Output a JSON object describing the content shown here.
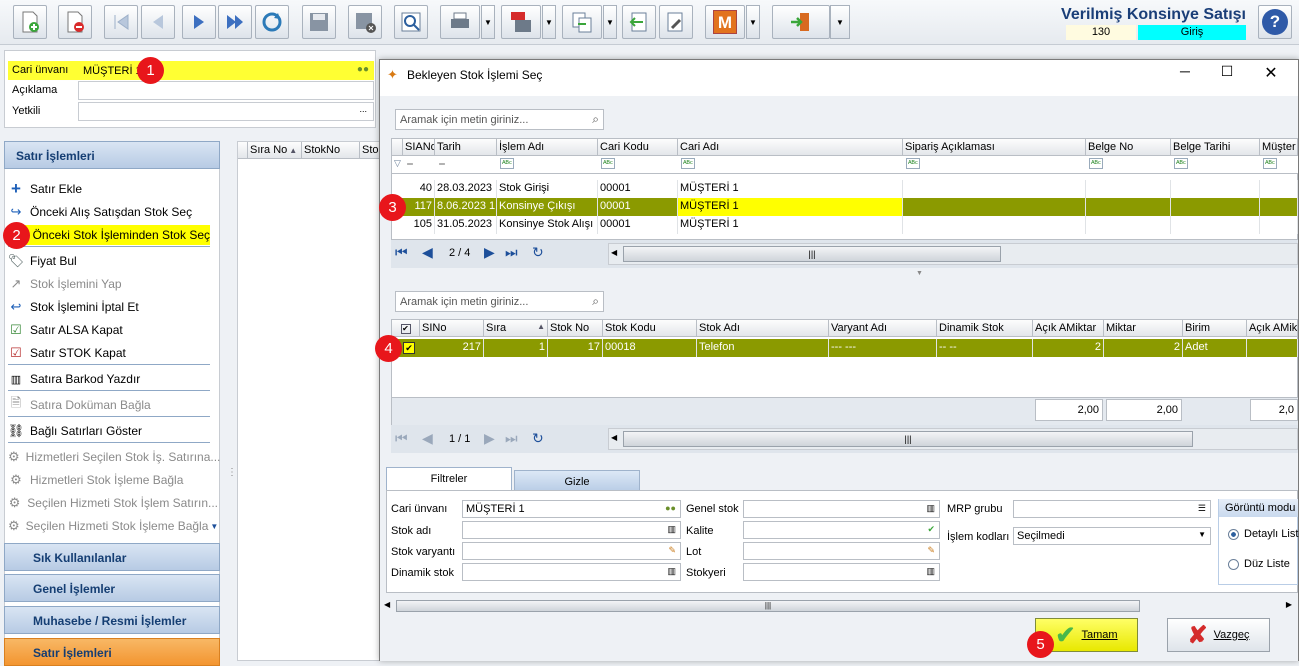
{
  "window_title": "Verilmiş Konsinye Satışı",
  "doc_number": "130",
  "doc_type": "Giriş",
  "header_fields": [
    {
      "label": "Cari ünvanı",
      "value": "MÜŞTERİ 1"
    },
    {
      "label": "Açıklama",
      "value": ""
    },
    {
      "label": "Yetkili",
      "value": "..."
    }
  ],
  "callouts": [
    "1",
    "2",
    "3",
    "4",
    "5"
  ],
  "nav": {
    "title": "Satır İşlemleri",
    "items": [
      {
        "label": "Satır Ekle",
        "icon": "plus-icon",
        "enabled": true
      },
      {
        "label": "Önceki Alış Satışdan Stok Seç",
        "icon": "redo-icon",
        "enabled": true
      },
      {
        "label": "Önceki Stok İşleminden Stok Seç",
        "icon": "redo-icon",
        "enabled": true,
        "highlight": true
      },
      {
        "label": "Fiyat Bul",
        "icon": "tag-icon",
        "enabled": true
      },
      {
        "label": "Stok İşlemini Yap",
        "icon": "share-icon",
        "enabled": false
      },
      {
        "label": "Stok İşlemini İptal Et",
        "icon": "undo-icon",
        "enabled": true
      },
      {
        "label": "Satır ALSA Kapat",
        "icon": "check-doc-icon",
        "enabled": true
      },
      {
        "label": "Satır STOK Kapat",
        "icon": "check-doc-icon",
        "enabled": true
      },
      {
        "label": "Satıra Barkod Yazdır",
        "icon": "barcode-icon",
        "enabled": true
      },
      {
        "label": "Satıra Doküman Bağla",
        "icon": "doc-icon",
        "enabled": false
      },
      {
        "label": "Bağlı Satırları Göster",
        "icon": "link-icon",
        "enabled": true
      },
      {
        "label": "Hizmetleri Seçilen Stok İş. Satırına...",
        "icon": "gear-icon",
        "enabled": false
      },
      {
        "label": "Hizmetleri Stok İşleme Bağla",
        "icon": "gear-icon",
        "enabled": false
      },
      {
        "label": "Seçilen Hizmeti Stok İşlem Satırın...",
        "icon": "gear-icon",
        "enabled": false
      },
      {
        "label": "Seçilen Hizmeti Stok İşleme Bağla",
        "icon": "gear-icon",
        "enabled": false
      }
    ],
    "groups": [
      "Sık Kullanılanlar",
      "Genel İşlemler",
      "Muhasebe / Resmi İşlemler",
      "Satır İşlemleri"
    ]
  },
  "main_grid_headers": [
    "Sıra No",
    "StokNo",
    "Sto"
  ],
  "dialog": {
    "title": "Bekleyen Stok İşlemi Seç",
    "search_placeholder_1": "Aramak için metin giriniz...",
    "search_placeholder_2": "Aramak için metin giriniz...",
    "grid1": {
      "headers": [
        "SIANo",
        "Tarih",
        "İşlem Adı",
        "Cari Kodu",
        "Cari Adı",
        "Sipariş Açıklaması",
        "Belge No",
        "Belge Tarihi",
        "Müşter"
      ],
      "rows": [
        [
          "40",
          "28.03.2023",
          "Stok Girişi",
          "00001",
          "MÜŞTERİ 1",
          "",
          "",
          "",
          ""
        ],
        [
          "117",
          "8.06.2023 1",
          "Konsinye Çıkışı",
          "00001",
          "MÜŞTERİ 1",
          "",
          "",
          "",
          ""
        ],
        [
          "105",
          "31.05.2023",
          "Konsinye Stok Alışı",
          "00001",
          "MÜŞTERİ 1",
          "",
          "",
          "",
          ""
        ]
      ],
      "page": "2 / 4"
    },
    "grid2": {
      "headers": [
        "SINo",
        "Sıra",
        "Stok No",
        "Stok Kodu",
        "Stok Adı",
        "Varyant Adı",
        "Dinamik Stok",
        "Açık AMiktar",
        "Miktar",
        "Birim",
        "Açık AMikt"
      ],
      "rows": [
        [
          "217",
          "1",
          "17",
          "00018",
          "Telefon",
          "--- ---",
          "-- --",
          "2",
          "2",
          "Adet",
          ""
        ]
      ],
      "totals": [
        "2,00",
        "2,00",
        "2,0"
      ],
      "page": "1 / 1"
    },
    "tabs": [
      "Filtreler",
      "Gizle"
    ],
    "filters": {
      "cari_unvani_label": "Cari ünvanı",
      "cari_unvani": "MÜŞTERİ 1",
      "stok_adi_label": "Stok adı",
      "stok_varyanti_label": "Stok varyantı",
      "dinamik_stok_label": "Dinamik stok",
      "genel_stok_label": "Genel stok",
      "kalite_label": "Kalite",
      "lot_label": "Lot",
      "stokyeri_label": "Stokyeri",
      "mrp_grubu_label": "MRP grubu",
      "islem_kodlari_label": "İşlem kodları",
      "islem_kodlari": "Seçilmedi",
      "gorunum_title": "Görüntü modu",
      "gorunum_opt1": "Detaylı Liste",
      "gorunum_opt2": "Düz Liste"
    },
    "ok_label": "Tamam",
    "cancel_label": "Vazgeç"
  },
  "colors": {
    "highlight": "#ffff00",
    "selected_row": "#8b9a00",
    "accent": "#1d4f9a"
  }
}
